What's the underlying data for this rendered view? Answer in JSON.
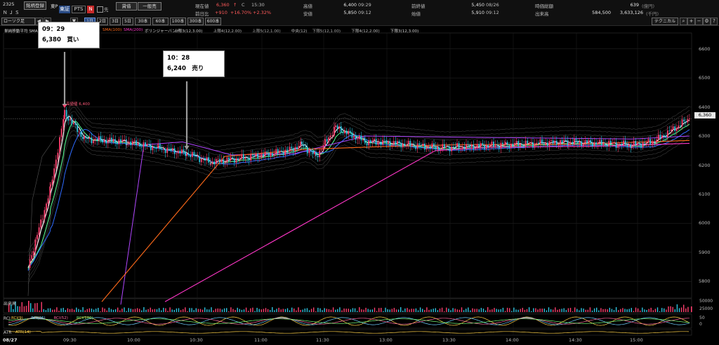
{
  "header": {
    "code": "2325",
    "name": "ＮＪＳ",
    "btn_register": "銘柄登録",
    "market_tag": "東P",
    "tab_tse": "東証",
    "tab_pts": "PTS",
    "n_badge": "N",
    "chk_label": "先",
    "btn_credit": "貸借",
    "btn_general": "一般売",
    "cur_label": "現在値",
    "cur_value": "6,360",
    "cur_arrow": "↑",
    "cur_flag": "C",
    "cur_time": "15:30",
    "prev_label": "前日比",
    "prev_change": "+910",
    "prev_pct1": "+16.70%",
    "prev_pct2": "+2.32%",
    "high_label": "高値",
    "high_value": "6,400",
    "high_time": "09:29",
    "low_label": "安値",
    "low_value": "5,850",
    "low_time": "09:12",
    "prevclose_label": "前終値",
    "prevclose_value": "5,450",
    "prevclose_date": "08/26",
    "open_label": "始値",
    "open_value": "5,910",
    "open_time": "09:12",
    "mcap_label": "時価総額",
    "mcap_value": "639",
    "mcap_unit": "(億円)",
    "vol_label": "出来高",
    "vol_value": "584,500",
    "turnover_value": "3,633,126",
    "turnover_unit": "(千円)"
  },
  "toolbar": {
    "chart_type": "ローソク足",
    "intervals": [
      "1日",
      "2日",
      "3日",
      "5日",
      "30本",
      "60本",
      "100本",
      "300本",
      "600本"
    ],
    "active_interval": "1日",
    "technical_btn": "テクニカル"
  },
  "chart": {
    "legend_left": "単純移動平均 SMA",
    "legend_sma100": "SMA(100)",
    "legend_sma200": "SMA(200)",
    "legend_bb": "ボリンジャーバンド",
    "legend_bb_items": [
      "上限3(12,3.00)",
      "上限4(12,2.00)",
      "上限5(12,1.00)",
      "中央(12)",
      "下限5(12,1.00)",
      "下限4(12,2.00)",
      "下限3(12,3.00)"
    ],
    "high_marker": "高値値 6,400",
    "current_price_label": "6,360",
    "price_ticks": [
      "6600",
      "6500",
      "6400",
      "6300",
      "6200",
      "6100",
      "6000",
      "5900",
      "5800"
    ],
    "time_ticks": [
      "08/27",
      "09:30",
      "10:00",
      "10:30",
      "11:00",
      "11:30",
      "13:00",
      "13:30",
      "14:00",
      "14:30",
      "15:00"
    ],
    "volume_panel": "出来高",
    "volume_ticks": [
      "50000",
      "25000"
    ],
    "rci_panel": "RCI",
    "rci_series": [
      "RCI(9)",
      "RCI(26)",
      "RCI(52)",
      "RCI(100)"
    ],
    "rci_ticks": [
      "50",
      "0"
    ],
    "atr_panel": "ATR",
    "atr_series": "ATR(14)"
  },
  "annotations": [
    {
      "time": "09：29",
      "text": "6,380　買い"
    },
    {
      "time": "10：28",
      "text": "6,240　売り"
    }
  ],
  "colors": {
    "up": "#ff3f6e",
    "down": "#2ec4e0",
    "sma5": "#ffffff",
    "sma_green": "#52ff8e",
    "sma_blue": "#2f6bff",
    "sma_purple": "#b146ff",
    "sma100": "#ff6a1a",
    "sma200": "#ff36c8",
    "active_tab": "#284a84"
  },
  "chart_data": {
    "type": "line",
    "x": [
      "09:12",
      "09:20",
      "09:29",
      "09:40",
      "10:00",
      "10:28",
      "10:40",
      "11:00",
      "11:15",
      "11:22",
      "11:30",
      "11:45",
      "12:30",
      "13:00",
      "13:30",
      "14:00",
      "14:30",
      "15:00",
      "15:10",
      "15:30"
    ],
    "series": [
      {
        "name": "",
        "values": [
          5850,
          6120,
          6380,
          6290,
          6280,
          6240,
          6210,
          6230,
          6250,
          6270,
          6230,
          6330,
          6280,
          6280,
          6260,
          6270,
          6280,
          6270,
          6280,
          6360
        ]
      }
    ],
    "ylim": [
      5750,
      6650
    ],
    "high": 6400,
    "current": 6360
  }
}
